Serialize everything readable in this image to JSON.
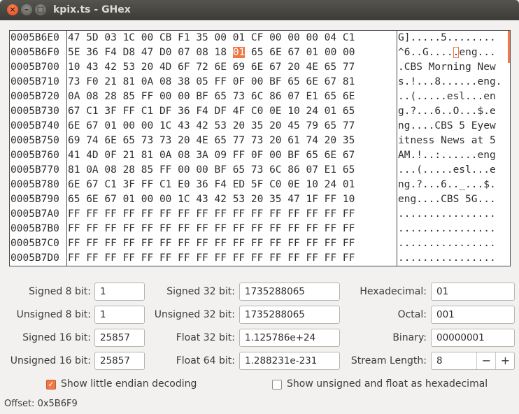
{
  "window": {
    "title": "kpix.ts - GHex",
    "close_glyph": "×",
    "min_glyph": "–",
    "max_glyph": "□"
  },
  "hex_view": {
    "offsets": [
      "0005B6E0",
      "0005B6F0",
      "0005B700",
      "0005B710",
      "0005B720",
      "0005B730",
      "0005B740",
      "0005B750",
      "0005B760",
      "0005B770",
      "0005B780",
      "0005B790",
      "0005B7A0",
      "0005B7B0",
      "0005B7C0",
      "0005B7D0"
    ],
    "hex_rows": [
      "47 5D 03 1C 00 CB F1 35 00 01 CF 00 00 00 04 C1",
      "5E 36 F4 D8 47 D0 07 08 18 01 65 6E 67 01 00 00",
      "10 43 42 53 20 4D 6F 72 6E 69 6E 67 20 4E 65 77",
      "73 F0 21 81 0A 08 38 05 FF 0F 00 BF 65 6E 67 81",
      "0A 08 28 85 FF 00 00 BF 65 73 6C 86 07 E1 65 6E",
      "67 C1 3F FF C1 DF 36 F4 DF 4F C0 0E 10 24 01 65",
      "6E 67 01 00 00 1C 43 42 53 20 35 20 45 79 65 77",
      "69 74 6E 65 73 73 20 4E 65 77 73 20 61 74 20 35",
      "41 4D 0F 21 81 0A 08 3A 09 FF 0F 00 BF 65 6E 67",
      "81 0A 08 28 85 FF 00 00 BF 65 73 6C 86 07 E1 65",
      "6E 67 C1 3F FF C1 E0 36 F4 ED 5F C0 0E 10 24 01",
      "65 6E 67 01 00 00 1C 43 42 53 20 35 47 1F FF 10",
      "FF FF FF FF FF FF FF FF FF FF FF FF FF FF FF FF",
      "FF FF FF FF FF FF FF FF FF FF FF FF FF FF FF FF",
      "FF FF FF FF FF FF FF FF FF FF FF FF FF FF FF FF",
      "FF FF FF FF FF FF FF FF FF FF FF FF FF FF FF FF"
    ],
    "ascii_rows": [
      "G].....5........",
      "^6..G.....eng...",
      ".CBS Morning New",
      "s.!...8......eng.",
      "..(.....esl...en",
      "g.?...6..O...$.e",
      "ng....CBS 5 Eyew",
      "itness News at 5",
      "AM.!..:......eng",
      "...(.....esl...e",
      "ng.?...6.._...$.",
      "eng....CBS 5G...",
      "................",
      "................",
      "................",
      "................"
    ],
    "cursor_row": 1,
    "cursor_col": 9,
    "accent_color": "#f07746"
  },
  "fields": {
    "signed8": {
      "label": "Signed 8 bit:",
      "value": "1"
    },
    "unsigned8": {
      "label": "Unsigned 8 bit:",
      "value": "1"
    },
    "signed16": {
      "label": "Signed 16 bit:",
      "value": "25857"
    },
    "unsigned16": {
      "label": "Unsigned 16 bit:",
      "value": "25857"
    },
    "signed32": {
      "label": "Signed 32 bit:",
      "value": "1735288065"
    },
    "unsigned32": {
      "label": "Unsigned 32 bit:",
      "value": "1735288065"
    },
    "float32": {
      "label": "Float 32 bit:",
      "value": "1.125786e+24"
    },
    "float64": {
      "label": "Float 64 bit:",
      "value": "1.288231e-231"
    },
    "hexadecimal": {
      "label": "Hexadecimal:",
      "value": "01"
    },
    "octal": {
      "label": "Octal:",
      "value": "001"
    },
    "binary": {
      "label": "Binary:",
      "value": "00000001"
    },
    "stream_length": {
      "label": "Stream Length:",
      "value": "8",
      "minus": "−",
      "plus": "+"
    }
  },
  "options": {
    "little_endian": {
      "label": "Show little endian decoding",
      "checked": true
    },
    "unsigned_hex": {
      "label": "Show unsigned and float as hexadecimal",
      "checked": false
    }
  },
  "status": {
    "offset_text": "Offset: 0x5B6F9"
  }
}
